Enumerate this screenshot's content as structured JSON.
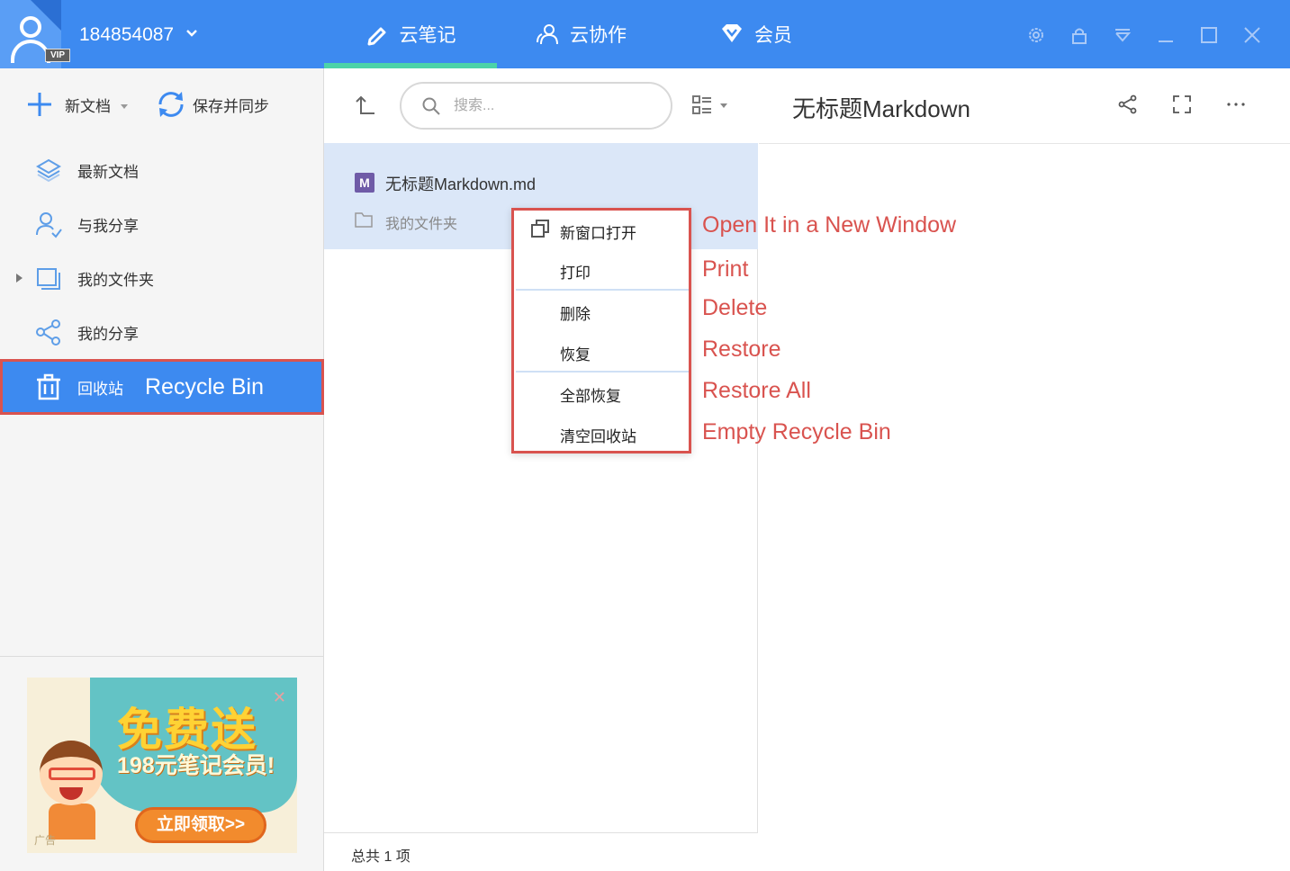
{
  "titlebar": {
    "username": "184854087",
    "vip_badge": "VIP",
    "tabs": [
      {
        "label": "云笔记",
        "icon": "pencil-icon"
      },
      {
        "label": "云协作",
        "icon": "people-icon"
      },
      {
        "label": "会员",
        "icon": "diamond-icon"
      }
    ],
    "window_controls": [
      "settings-icon",
      "lock-icon",
      "dropdown-icon",
      "minimize-icon",
      "maximize-icon",
      "close-icon"
    ],
    "accent_color": "#3d8af0",
    "tab_underline_color": "#4cd3a8"
  },
  "sidebar": {
    "new_doc_label": "新文档",
    "sync_label": "保存并同步",
    "items": [
      {
        "label": "最新文档",
        "icon": "layers-icon"
      },
      {
        "label": "与我分享",
        "icon": "user-share-icon"
      },
      {
        "label": "我的文件夹",
        "icon": "folder-icon"
      },
      {
        "label": "我的分享",
        "icon": "share-icon"
      },
      {
        "label": "回收站",
        "icon": "trash-icon",
        "active": true,
        "annotation": "Recycle Bin"
      }
    ],
    "ad": {
      "headline": "免费送",
      "subline": "198元笔记会员!",
      "button": "立即领取>>",
      "label": "广告"
    }
  },
  "list": {
    "search_placeholder": "搜索...",
    "file": {
      "name": "无标题Markdown.md",
      "icon_letter": "M",
      "path": "我的文件夹"
    },
    "footer": "总共 1 项"
  },
  "preview": {
    "title": "无标题Markdown"
  },
  "context_menu": {
    "items": [
      {
        "label": "新窗口打开",
        "annotation": "Open It in a New Window"
      },
      {
        "label": "打印",
        "annotation": "Print"
      },
      {
        "label": "删除",
        "annotation": "Delete"
      },
      {
        "label": "恢复",
        "annotation": "Restore"
      },
      {
        "label": "全部恢复",
        "annotation": "Restore All"
      },
      {
        "label": "清空回收站",
        "annotation": "Empty Recycle Bin"
      }
    ],
    "highlight_color": "#d9534f"
  }
}
